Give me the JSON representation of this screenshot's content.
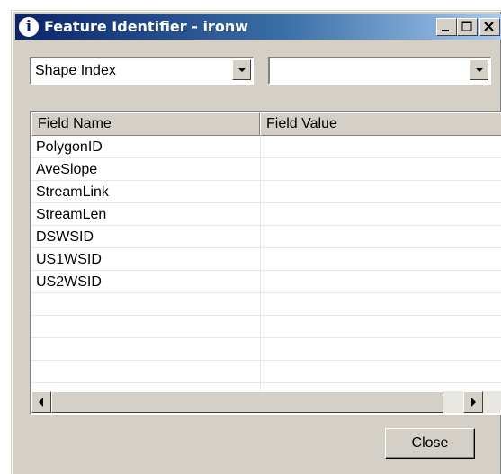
{
  "window": {
    "title": "Feature Identifier - ironw",
    "title_icon_glyph": "i",
    "controls": [
      "minimize-icon",
      "maximize-icon",
      "close-icon"
    ],
    "colors": {
      "face": "#d4d0c8",
      "title_start": "#0a246a",
      "title_end": "#a6caf0"
    }
  },
  "selectors": {
    "layer_value": "Shape Index",
    "feature_value": ""
  },
  "table": {
    "columns": [
      "Field Name",
      "Field Value"
    ],
    "rows": [
      {
        "name": "PolygonID",
        "value": ""
      },
      {
        "name": "AveSlope",
        "value": ""
      },
      {
        "name": "StreamLink",
        "value": ""
      },
      {
        "name": "StreamLen",
        "value": ""
      },
      {
        "name": "DSWSID",
        "value": ""
      },
      {
        "name": "US1WSID",
        "value": ""
      },
      {
        "name": "US2WSID",
        "value": ""
      },
      {
        "name": "",
        "value": ""
      },
      {
        "name": "",
        "value": ""
      },
      {
        "name": "",
        "value": ""
      },
      {
        "name": "",
        "value": ""
      }
    ]
  },
  "buttons": {
    "close_label": "Close"
  }
}
